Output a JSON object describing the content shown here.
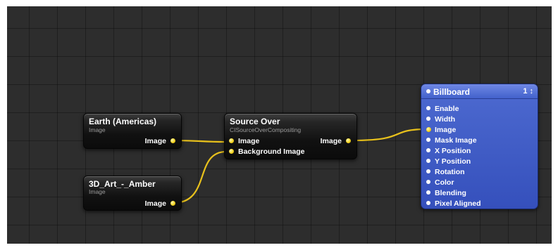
{
  "patches": {
    "earth": {
      "title": "Earth (Americas)",
      "subtitle": "Image",
      "output_label": "Image"
    },
    "art": {
      "title": "3D_Art_-_Amber",
      "subtitle": "Image",
      "output_label": "Image"
    },
    "source_over": {
      "title": "Source Over",
      "subtitle": "CISourceOverCompositing",
      "input_image": "Image",
      "input_background": "Background Image",
      "output_label": "Image"
    },
    "billboard": {
      "title": "Billboard",
      "layer": "1 ↕",
      "inputs": [
        "Enable",
        "Width",
        "Image",
        "Mask Image",
        "X Position",
        "Y Position",
        "Rotation",
        "Color",
        "Blending",
        "Pixel Aligned"
      ]
    }
  },
  "colors": {
    "canvas": "#2d2d2d",
    "wire": "#e8c11c",
    "port_yellow": "#f4d321",
    "billboard_blue": "#3f5bc6"
  }
}
